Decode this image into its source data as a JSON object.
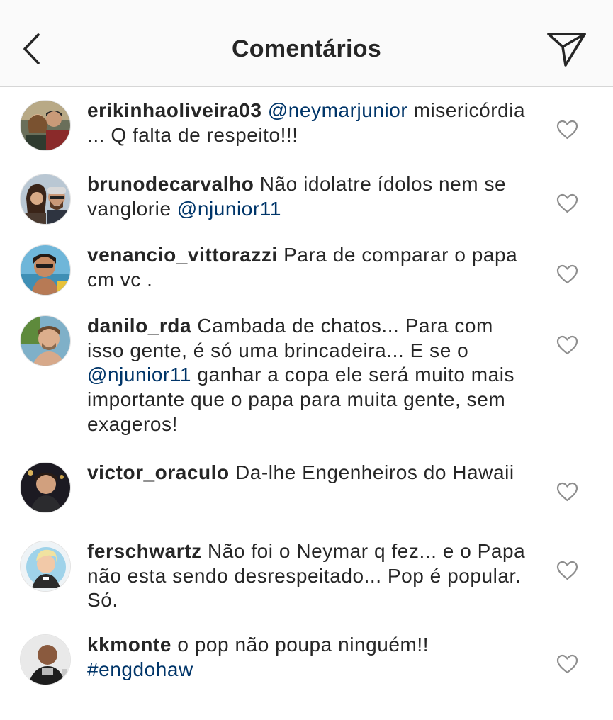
{
  "header": {
    "title": "Comentários",
    "back_icon": "chevron-left-icon",
    "send_icon": "paper-plane-icon"
  },
  "colors": {
    "text": "#262626",
    "mention": "#003569",
    "header_bg": "#fafafa",
    "divider": "#d6d6d6",
    "icon_gray": "#8e8e8e"
  },
  "comments": [
    {
      "username": "erikinhaoliveira03",
      "segments": [
        {
          "text": " "
        },
        {
          "mention": "@neymarjunior"
        },
        {
          "text": " misericórdia ... Q falta de respeito!!!"
        }
      ]
    },
    {
      "username": "brunodecarvalho",
      "segments": [
        {
          "text": " Não idolatre ídolos nem se vanglorie "
        },
        {
          "mention": "@njunior11"
        }
      ]
    },
    {
      "username": "venancio_vittorazzi",
      "segments": [
        {
          "text": " Para de comparar o papa cm vc ."
        }
      ]
    },
    {
      "username": "danilo_rda",
      "segments": [
        {
          "text": " Cambada de chatos... Para com isso gente, é só uma brincadeira... E se o "
        },
        {
          "mention": "@njunior11"
        },
        {
          "text": " ganhar a copa ele será muito mais importante que o papa para muita gente, sem exageros!"
        }
      ]
    },
    {
      "username": "victor_oraculo",
      "segments": [
        {
          "text": " Da-lhe Engenheiros do Hawaii"
        }
      ]
    },
    {
      "username": "ferschwartz",
      "segments": [
        {
          "text": " Não foi o Neymar q fez... e o Papa não esta sendo desrespeitado... Pop é popular. Só."
        }
      ]
    },
    {
      "username": "kkmonte",
      "segments": [
        {
          "text": " o pop não poupa ninguém!! "
        },
        {
          "mention": "#engdohaw"
        }
      ]
    }
  ],
  "like_icon": "heart-outline-icon"
}
